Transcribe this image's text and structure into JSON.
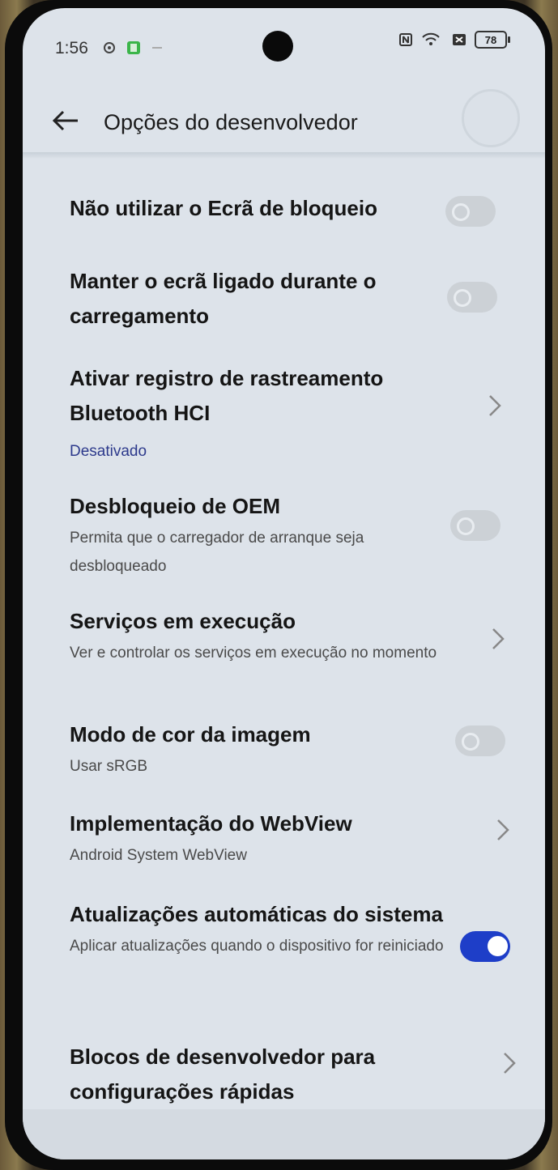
{
  "status": {
    "time": "1:56",
    "battery": "78"
  },
  "header": {
    "title": "Opções do desenvolvedor"
  },
  "items": [
    {
      "title": "Não utilizar o Ecrã de bloqueio",
      "control": "toggle",
      "state": "off"
    },
    {
      "title": "Manter o ecrã ligado durante o carregamento",
      "control": "toggle",
      "state": "off"
    },
    {
      "title": "Ativar registro de rastreamento Bluetooth HCI",
      "subtitle": "Desativado",
      "control": "chevron"
    },
    {
      "title": "Desbloqueio de OEM",
      "subtitle": "Permita que o carregador de arranque seja desbloqueado",
      "control": "toggle",
      "state": "off"
    },
    {
      "title": "Serviços em execução",
      "subtitle": "Ver e controlar os serviços em execução no momento",
      "control": "chevron"
    },
    {
      "title": "Modo de cor da imagem",
      "subtitle": "Usar sRGB",
      "control": "toggle",
      "state": "off"
    },
    {
      "title": "Implementação do WebView",
      "subtitle": "Android System WebView",
      "control": "chevron"
    },
    {
      "title": "Atualizações automáticas do sistema",
      "subtitle": "Aplicar atualizações quando o dispositivo for reiniciado",
      "control": "toggle",
      "state": "on"
    },
    {
      "title": "Blocos de desenvolvedor para configurações rápidas",
      "control": "chevron"
    }
  ],
  "colors": {
    "accent": "#1e3ec8",
    "link": "#2d3a8c",
    "background": "#dde3ea"
  }
}
